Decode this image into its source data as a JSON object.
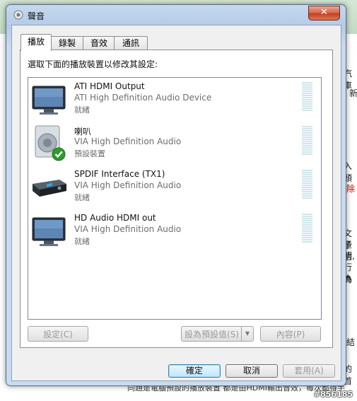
{
  "background": {
    "right_texts": [
      "汽車",
      "新",
      "入頭",
      "除",
      "文章",
      "子信",
      "明,",
      "行為",
      "為",
      "結",
      "的首"
    ],
    "bottom_text": "同題是電腦預設的播放裝置 都是由HDMI輸出音效，每次都得手",
    "watermark": "#856185"
  },
  "window": {
    "title": "聲音",
    "close_label": "✕"
  },
  "tabs": [
    {
      "label": "播放"
    },
    {
      "label": "錄製"
    },
    {
      "label": "音效"
    },
    {
      "label": "通訊"
    }
  ],
  "instruction": "選取下面的播放裝置以修改其設定:",
  "devices": [
    {
      "name": "ATI HDMI Output",
      "description": "ATI High Definition Audio Device",
      "status": "就緒",
      "icon": "monitor-icon"
    },
    {
      "name": "喇叭",
      "description": "VIA High Definition Audio",
      "status": "預設裝置",
      "icon": "speaker-icon"
    },
    {
      "name": "SPDIF Interface (TX1)",
      "description": "VIA High Definition Audio",
      "status": "就緒",
      "icon": "receiver-icon"
    },
    {
      "name": "HD Audio HDMI out",
      "description": "VIA High Definition Audio",
      "status": "就緒",
      "icon": "monitor-icon"
    }
  ],
  "buttons": {
    "configure": "設定(C)",
    "set_default": "設為預設值(S)",
    "properties": "內容(P)",
    "ok": "確定",
    "cancel": "取消",
    "apply": "套用(A)"
  },
  "colors": {
    "default_check": "#2e9a2e",
    "level_meter": "#cfe6ea"
  }
}
